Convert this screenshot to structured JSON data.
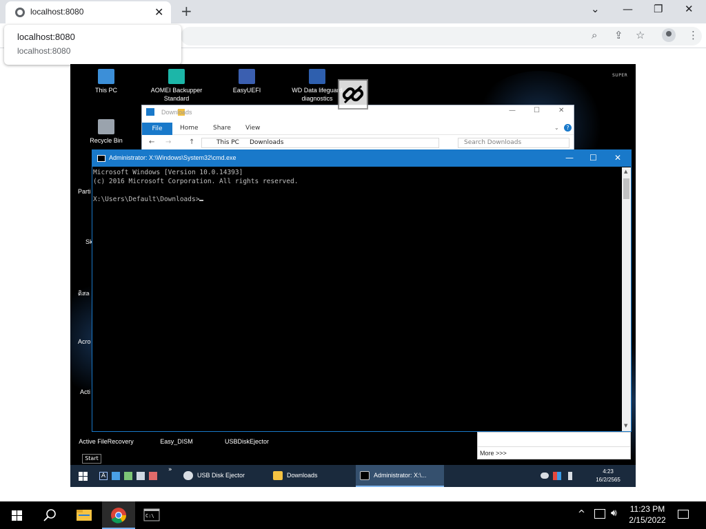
{
  "browser": {
    "tab_title": "localhost:8080",
    "popup_title": "localhost:8080",
    "popup_url": "localhost:8080"
  },
  "desktop": {
    "icons": [
      {
        "label": "This PC"
      },
      {
        "label": "AOMEI Backupper Standard"
      },
      {
        "label": "EasyUEFI"
      },
      {
        "label": "WD Data lifeguard diagnostics"
      },
      {
        "label": "Recycle Bin"
      },
      {
        "label": "Active FileRecovery"
      },
      {
        "label": "Easy_DISM"
      },
      {
        "label": "USBDiskEjector"
      }
    ],
    "side_labels": [
      "Parti",
      "Sk",
      "ดิสล",
      "Acro",
      "Acti"
    ]
  },
  "explorer": {
    "title": "Downloads",
    "tabs": {
      "file": "File",
      "home": "Home",
      "share": "Share",
      "view": "View"
    },
    "address": {
      "root": "This PC",
      "folder": "Downloads"
    },
    "search_placeholder": "Search Downloads"
  },
  "cmd": {
    "title": "Administrator: X:\\Windows\\System32\\cmd.exe",
    "line1": "Microsoft Windows [Version 10.0.14393]",
    "line2": "(c) 2016 Microsoft Corporation. All rights reserved.",
    "prompt": "X:\\Users\\Default\\Downloads>"
  },
  "more_panel": {
    "label": "More >>>"
  },
  "start_tooltip": "Start",
  "remote_taskbar": {
    "tasks": [
      {
        "label": "USB Disk Ejector"
      },
      {
        "label": "Downloads"
      },
      {
        "label": "Administrator: X:\\..."
      }
    ],
    "clock_time": "4:23",
    "clock_date": "16/2/2565"
  },
  "windows_taskbar": {
    "time": "11:23 PM",
    "date": "2/15/2022"
  },
  "colors": {
    "accent_blue": "#1979ca",
    "remote_taskbar": "#1a2a3d",
    "desktop_bg": "#000000"
  }
}
